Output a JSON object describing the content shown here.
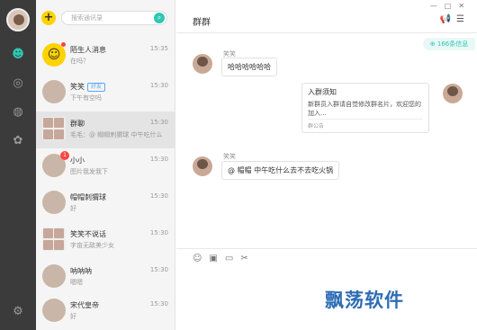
{
  "search": {
    "placeholder": "搜索通讯录",
    "add_icon": "plus-icon",
    "go_icon": "search-icon"
  },
  "rail": {
    "icons": [
      "chat-icon",
      "contact-icon",
      "group-icon",
      "discover-icon",
      "settings-icon"
    ]
  },
  "conversations": [
    {
      "name": "陌生人消息",
      "preview": "在吗？",
      "time": "15:35"
    },
    {
      "name": "笑笑",
      "tag": "好友",
      "preview": "下午有空吗",
      "time": "15:30"
    },
    {
      "name": "群聊",
      "preview": "毛毛：@ 帽帽刺猬球  中午吃什么",
      "time": "15:30"
    },
    {
      "name": "小小",
      "badge": "1",
      "preview": "图片我发我下",
      "time": "15:30"
    },
    {
      "name": "帽帽刺猬球",
      "preview": "好",
      "time": "15:30"
    },
    {
      "name": "笑笑不说话",
      "preview": "字亩无敌美少女",
      "time": "15:30"
    },
    {
      "name": "呐呐呐",
      "preview": "嗯嗯",
      "time": "15:30"
    },
    {
      "name": "宋代皇帝",
      "preview": "好",
      "time": "15:30"
    }
  ],
  "chat": {
    "title": "群群",
    "members": "166条信息",
    "messages": [
      {
        "sender": "笑笑",
        "text": "哈哈哈哈哈哈"
      },
      {
        "sender": "笑笑",
        "text": "@ 帽帽   中午吃什么去不去吃火锅"
      }
    ],
    "notice": {
      "title": "入群须知",
      "body": "新群员入群请自觉修改群名片，欢迎您的加入...",
      "footer": "群公告"
    },
    "toolbar_icons": [
      "emoji-icon",
      "image-icon",
      "folder-icon",
      "scissors-icon"
    ]
  },
  "watermark": "飘荡软件"
}
